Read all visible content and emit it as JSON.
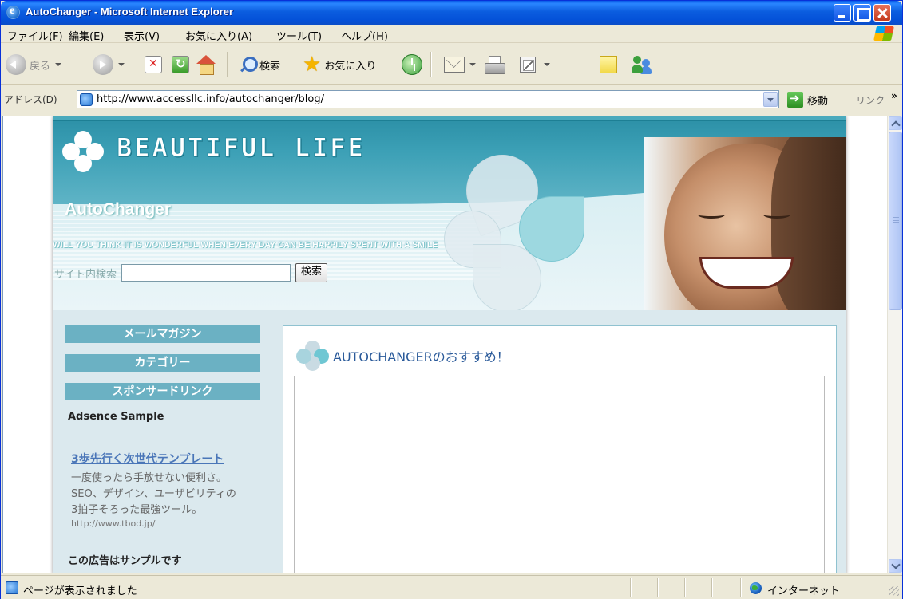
{
  "window": {
    "title": "AutoChanger - Microsoft Internet Explorer"
  },
  "menu": {
    "items": [
      "ファイル(F)",
      "編集(E)",
      "表示(V)",
      "お気に入り(A)",
      "ツール(T)",
      "ヘルプ(H)"
    ]
  },
  "toolbar": {
    "back_label": "戻る",
    "search_label": "検索",
    "favorites_label": "お気に入り"
  },
  "address": {
    "label": "アドレス(D)",
    "url": "http://www.accessllc.info/autochanger/blog/",
    "go_label": "移動",
    "links_label": "リンク",
    "links_chevron": "»"
  },
  "page": {
    "logo_text": "BEAUTIFUL LIFE",
    "site_name": "AutoChanger",
    "tagline": "WILL YOU THINK IT IS WONDERFUL WHEN EVERY DAY CAN BE HAPPILY SPENT WITH A SMILE",
    "search_label": "サイト内検索",
    "search_value": "",
    "search_button": "検索",
    "sidebar": {
      "headings": [
        "メールマガジン",
        "カテゴリー",
        "スポンサードリンク"
      ],
      "ad_sample": "Adsence Sample",
      "ad_title": "3歩先行く次世代テンプレート",
      "ad_lines": [
        "一度使ったら手放せない便利さ。",
        "SEO、デザイン、ユーザビリティの",
        "3拍子そろった最強ツール。"
      ],
      "ad_url": "http://www.tbod.jp/",
      "ad_note": "この広告はサンプルです"
    },
    "main_title": "AUTOCHANGERのおすすめ！"
  },
  "status": {
    "text": "ページが表示されました",
    "zone": "インターネット"
  },
  "colors": {
    "title_bar": "#0a5ce8",
    "header_teal": "#2b8fa6",
    "sidebar_heading": "#6bb1c3",
    "page_bg": "#dbe9ee",
    "main_title": "#2a5a9a",
    "ad_link": "#4a76b8"
  },
  "icons": [
    "ie-icon",
    "windows-logo-icon",
    "back-icon",
    "forward-icon",
    "stop-icon",
    "refresh-icon",
    "home-icon",
    "search-icon",
    "favorites-star-icon",
    "history-icon",
    "mail-icon",
    "print-icon",
    "edit-icon",
    "discuss-icon",
    "messenger-icon",
    "page-icon",
    "go-arrow-icon",
    "clover-icon",
    "internet-zone-icon"
  ]
}
